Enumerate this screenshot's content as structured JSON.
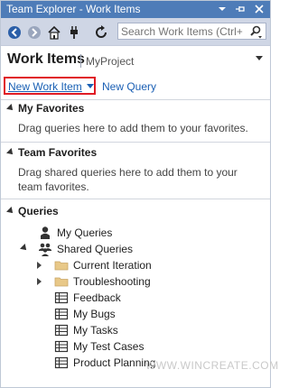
{
  "window": {
    "title": "Team Explorer - Work Items",
    "controls": [
      "dropdown-icon",
      "pin-icon",
      "close-icon"
    ]
  },
  "toolbar": {
    "buttons": [
      "back-icon",
      "forward-icon",
      "home-icon",
      "connect-icon",
      "refresh-icon"
    ],
    "search_placeholder": "Search Work Items (Ctrl+"
  },
  "heading": {
    "title": "Work Items",
    "project": "MyProject"
  },
  "actions": {
    "new_work_item": "New Work Item",
    "new_query": "New Query"
  },
  "sections": {
    "my_favorites": {
      "title": "My Favorites",
      "hint": "Drag queries here to add them to your favorites."
    },
    "team_favorites": {
      "title": "Team Favorites",
      "hint": "Drag shared queries here to add them to your team favorites."
    },
    "queries": {
      "title": "Queries",
      "items": [
        {
          "label": "My Queries",
          "icon": "user-icon"
        },
        {
          "label": "Shared Queries",
          "icon": "group-icon"
        },
        {
          "label": "Current Iteration",
          "icon": "folder-icon"
        },
        {
          "label": "Troubleshooting",
          "icon": "folder-icon"
        },
        {
          "label": "Feedback",
          "icon": "query-grid-icon"
        },
        {
          "label": "My Bugs",
          "icon": "query-grid-icon"
        },
        {
          "label": "My Tasks",
          "icon": "query-grid-icon"
        },
        {
          "label": "My Test Cases",
          "icon": "query-grid-icon"
        },
        {
          "label": "Product Planning",
          "icon": "query-grid-icon"
        }
      ]
    }
  },
  "watermark": "WWW.WINCREATE.COM",
  "colors": {
    "title_bar": "#4e7cb8",
    "toolbar": "#cfd6e5",
    "link": "#1a5fb4",
    "highlight_border": "#e01b24",
    "folder": "#e8c888"
  }
}
